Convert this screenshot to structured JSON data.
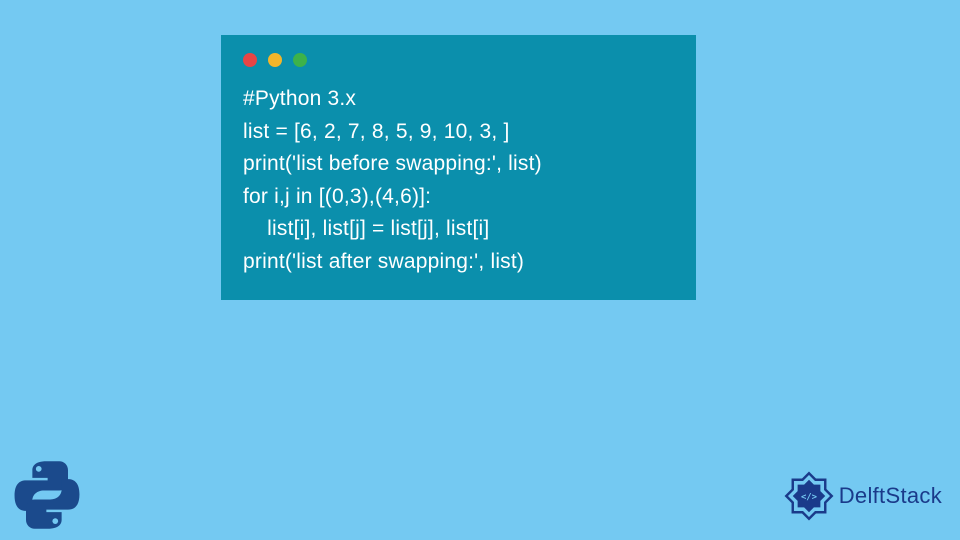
{
  "code": {
    "line1": "#Python 3.x",
    "line2": "list = [6, 2, 7, 8, 5, 9, 10, 3, ]",
    "line3": "print('list before swapping:', list)",
    "line4": "for i,j in [(0,3),(4,6)]:",
    "line5": "    list[i], list[j] = list[j], list[i]",
    "line6": "print('list after swapping:', list)"
  },
  "brand": {
    "name": "DelftStack"
  },
  "colors": {
    "bg": "#74c9f2",
    "window": "#0b8fac",
    "red": "#e84545",
    "yellow": "#f3b52a",
    "green": "#3db24a",
    "delft_blue": "#1a3a8a"
  }
}
